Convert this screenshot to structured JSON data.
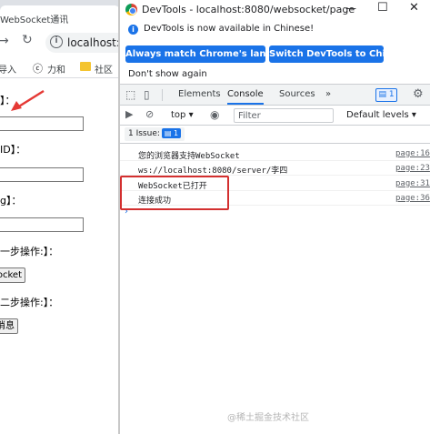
{
  "browser": {
    "tab_title": "WebSocket通讯",
    "address": "localhost:",
    "bookmarks": [
      "导入",
      "力和",
      "社区"
    ],
    "fields": [
      {
        "label": "】：",
        "value": ""
      },
      {
        "label": "ID】：",
        "value": ""
      },
      {
        "label": "g】：",
        "value": ""
      }
    ],
    "step1_label": "一步操作:】：",
    "step1_button": "ocket",
    "step2_label": "二步操作:】：",
    "step2_button": "消息"
  },
  "devtools": {
    "title": "DevTools - localhost:8080/websocket/page",
    "banner_text": "DevTools is now available in Chinese!",
    "btn_match": "Always match Chrome's language",
    "btn_switch": "Switch DevTools to Chinese",
    "dont_show": "Don't show again",
    "tabs": [
      "Elements",
      "Console",
      "Sources"
    ],
    "active_tab": "Console",
    "more_tabs": "»",
    "msg_count": "1",
    "context": "top",
    "filter_placeholder": "Filter",
    "levels": "Default levels",
    "issue_text": "1 Issue:",
    "issue_count": "1",
    "console_lines": [
      {
        "text": "您的浏览器支持WebSocket",
        "source": "page:16"
      },
      {
        "text": "ws://localhost:8080/server/李四",
        "source": "page:23"
      },
      {
        "text": "WebSocket已打开",
        "source": "page:31"
      },
      {
        "text": "连接成功",
        "source": "page:36"
      }
    ],
    "prompt": "›"
  },
  "watermark": "@稀土掘金技术社区",
  "colors": {
    "accent": "#1a73e8",
    "highlight_box": "#d32f2f",
    "arrow": "#e53935"
  }
}
